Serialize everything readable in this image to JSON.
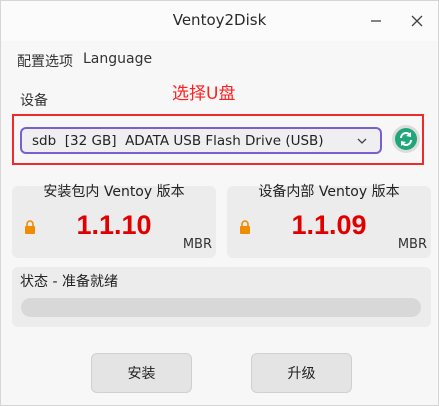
{
  "window": {
    "title": "Ventoy2Disk"
  },
  "menu": {
    "items": [
      "配置选项",
      "Language"
    ]
  },
  "device": {
    "label": "设备",
    "annotation": "选择U盘",
    "selected": "sdb  [32 GB]  ADATA USB Flash Drive (USB)"
  },
  "panels": {
    "package": {
      "header": "安装包内 Ventoy 版本",
      "version": "1.1.10",
      "style": "MBR"
    },
    "device": {
      "header": "设备内部 Ventoy 版本",
      "version": "1.1.09",
      "style": "MBR"
    }
  },
  "status": {
    "label": "状态 - 准备就绪",
    "progress": 0
  },
  "buttons": {
    "install": "安装",
    "update": "升级"
  },
  "colors": {
    "accent": "#7b5fd1",
    "annotation_red": "#ee2a2a",
    "version_red": "#e00000",
    "refresh_green": "#1fa67a",
    "lock_orange": "#f08c00"
  },
  "icons": {
    "minimize": "minimize-icon",
    "close": "close-icon",
    "dropdown": "chevron-down-icon",
    "refresh": "refresh-icon",
    "lock": "lock-icon"
  }
}
